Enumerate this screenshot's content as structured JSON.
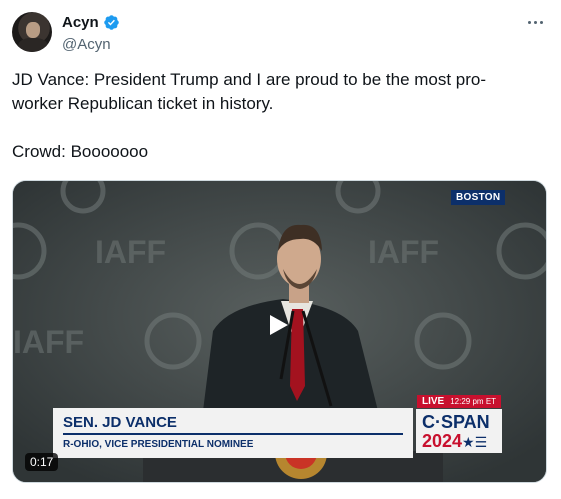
{
  "author": {
    "name": "Acyn",
    "handle": "@Acyn",
    "verified_icon": "verified-badge-icon",
    "verified_color": "#1d9bf0"
  },
  "tweet": {
    "line1": "JD Vance: President Trump and I are proud to be the most pro-worker Republican ticket in history.",
    "line2": "Crowd: Booooooo"
  },
  "video": {
    "duration": "0:17",
    "location_bug": "BOSTON",
    "live_label": "LIVE",
    "live_time": "12:29 pm ET",
    "chyron_name": "SEN. JD VANCE",
    "chyron_sub": "R-OHIO, VICE PRESIDENTIAL NOMINEE",
    "network_line1": "C·SPAN",
    "network_line2": "2024",
    "backdrop_text": "IAFF",
    "play_icon": "play-icon"
  },
  "colors": {
    "text": "#0f1419",
    "secondary": "#536471",
    "cspan_blue": "#0c2f6a",
    "cspan_red": "#c8102e"
  }
}
